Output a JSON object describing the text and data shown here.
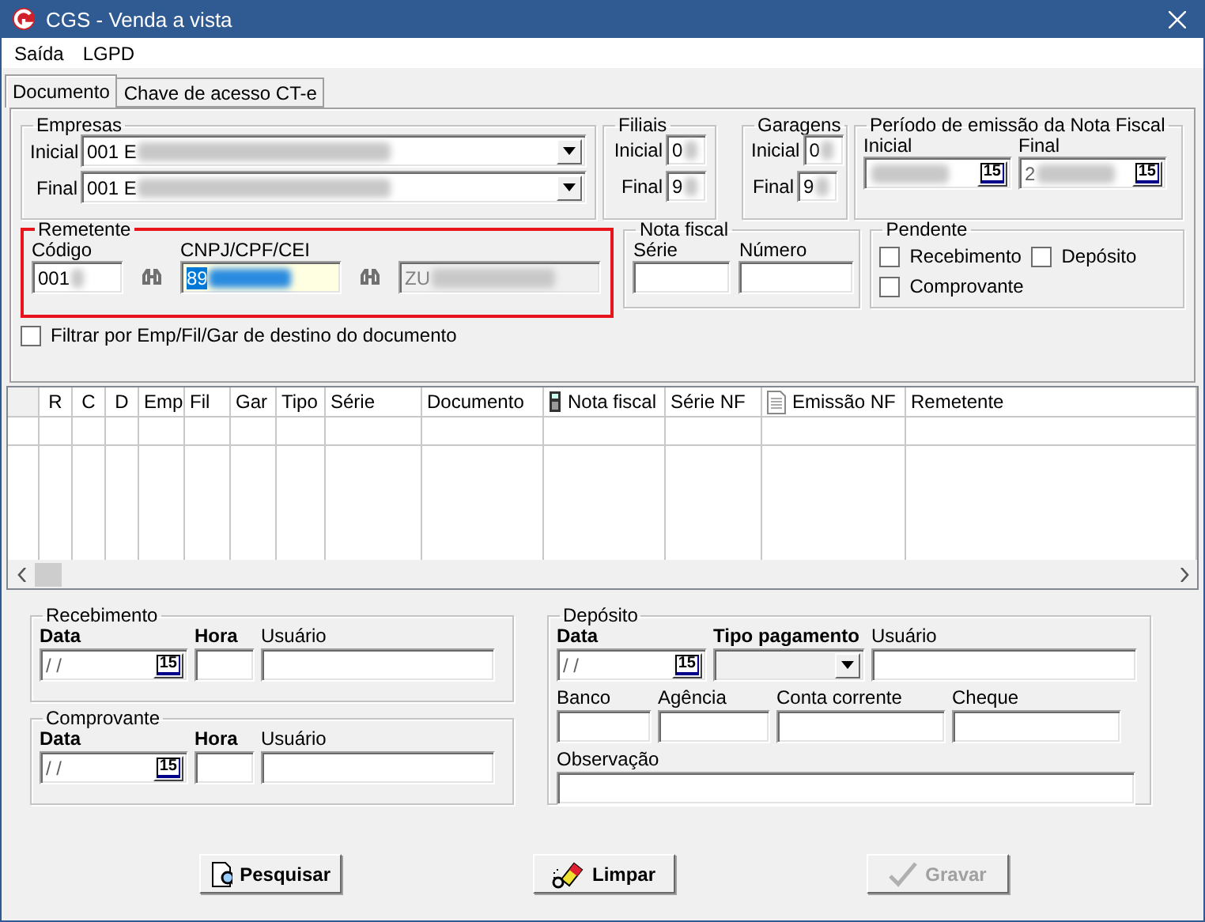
{
  "window": {
    "title": "CGS - Venda a vista"
  },
  "menu": [
    {
      "label": "Saída"
    },
    {
      "label": "LGPD"
    }
  ],
  "tabs": [
    {
      "label": "Documento",
      "selected": true
    },
    {
      "label": "Chave de acesso CT-e",
      "selected": false
    }
  ],
  "empresas": {
    "legend": "Empresas",
    "rows": [
      {
        "label": "Inicial",
        "value": "001 E",
        "redacted": true
      },
      {
        "label": "Final",
        "value": "001 E",
        "redacted": true
      }
    ]
  },
  "filiais": {
    "legend": "Filiais",
    "rows": [
      {
        "label": "Inicial",
        "value": "0",
        "redacted": true
      },
      {
        "label": "Final",
        "value": "9",
        "redacted": true
      }
    ]
  },
  "garagens": {
    "legend": "Garagens",
    "rows": [
      {
        "label": "Inicial",
        "value": "0",
        "redacted": true
      },
      {
        "label": "Final",
        "value": "9",
        "redacted": true
      }
    ]
  },
  "periodo": {
    "legend": "Período de emissão da Nota Fiscal",
    "fields": [
      {
        "label": "Inicial",
        "redacted": true,
        "button": "15"
      },
      {
        "label": "Final",
        "value": "2",
        "redacted": true,
        "button": "15"
      }
    ]
  },
  "remetente": {
    "legend": "Remetente",
    "highlighted": true,
    "codigo": {
      "label": "Código",
      "value": "001",
      "redacted": true
    },
    "cnpj": {
      "label": "CNPJ/CPF/CEI",
      "value": "89",
      "redacted": true,
      "focused": true
    },
    "nome": {
      "value": "ZU",
      "redacted": true,
      "disabled": true
    }
  },
  "nota_fiscal": {
    "legend": "Nota fiscal",
    "fields": [
      {
        "label": "Série"
      },
      {
        "label": "Número"
      }
    ]
  },
  "pendente": {
    "legend": "Pendente",
    "options": [
      {
        "label": "Recebimento",
        "checked": false
      },
      {
        "label": "Depósito",
        "checked": false
      },
      {
        "label": "Comprovante",
        "checked": false
      }
    ]
  },
  "filter_checkbox": {
    "label": "Filtrar por Emp/Fil/Gar de destino do documento",
    "checked": false
  },
  "table": {
    "columns": [
      {
        "label": "R"
      },
      {
        "label": "C"
      },
      {
        "label": "D"
      },
      {
        "label": "Emp"
      },
      {
        "label": "Fil"
      },
      {
        "label": "Gar"
      },
      {
        "label": "Tipo"
      },
      {
        "label": "Série"
      },
      {
        "label": "Documento"
      },
      {
        "label": "Nota fiscal",
        "kind": "device"
      },
      {
        "label": "Série NF"
      },
      {
        "label": "Emissão NF",
        "kind": "document"
      },
      {
        "label": "Remetente"
      }
    ]
  },
  "recebimento": {
    "legend": "Recebimento",
    "fields": [
      {
        "label": "Data",
        "kind": "date",
        "emphasized": true,
        "value": "/ /",
        "button": "15"
      },
      {
        "label": "Hora",
        "kind": "text",
        "emphasized": true
      },
      {
        "label": "Usuário",
        "kind": "text",
        "emphasized": false
      }
    ]
  },
  "comprovante": {
    "legend": "Comprovante",
    "fields": [
      {
        "label": "Data",
        "kind": "date",
        "emphasized": true,
        "value": "/ /",
        "button": "15"
      },
      {
        "label": "Hora",
        "kind": "text",
        "emphasized": true
      },
      {
        "label": "Usuário",
        "kind": "text",
        "emphasized": false
      }
    ]
  },
  "deposito": {
    "legend": "Depósito",
    "rows": [
      [
        {
          "label": "Data",
          "kind": "date",
          "emphasized": true,
          "value": "/ /",
          "button": "15"
        },
        {
          "label": "Tipo pagamento",
          "kind": "combo",
          "emphasized": true,
          "disabled": true
        },
        {
          "label": "Usuário",
          "kind": "text",
          "emphasized": false
        }
      ],
      [
        {
          "label": "Banco",
          "kind": "text",
          "emphasized": false
        },
        {
          "label": "Agência",
          "kind": "text",
          "emphasized": false
        },
        {
          "label": "Conta corrente",
          "kind": "text",
          "emphasized": false
        },
        {
          "label": "Cheque",
          "kind": "text",
          "emphasized": false
        }
      ],
      [
        {
          "label": "Observação",
          "kind": "text",
          "emphasized": false
        }
      ]
    ]
  },
  "buttons": [
    {
      "label": "Pesquisar",
      "kind": "search",
      "disabled": false
    },
    {
      "label": "Limpar",
      "kind": "clear",
      "disabled": false
    },
    {
      "label": "Gravar",
      "kind": "save",
      "disabled": true
    }
  ]
}
